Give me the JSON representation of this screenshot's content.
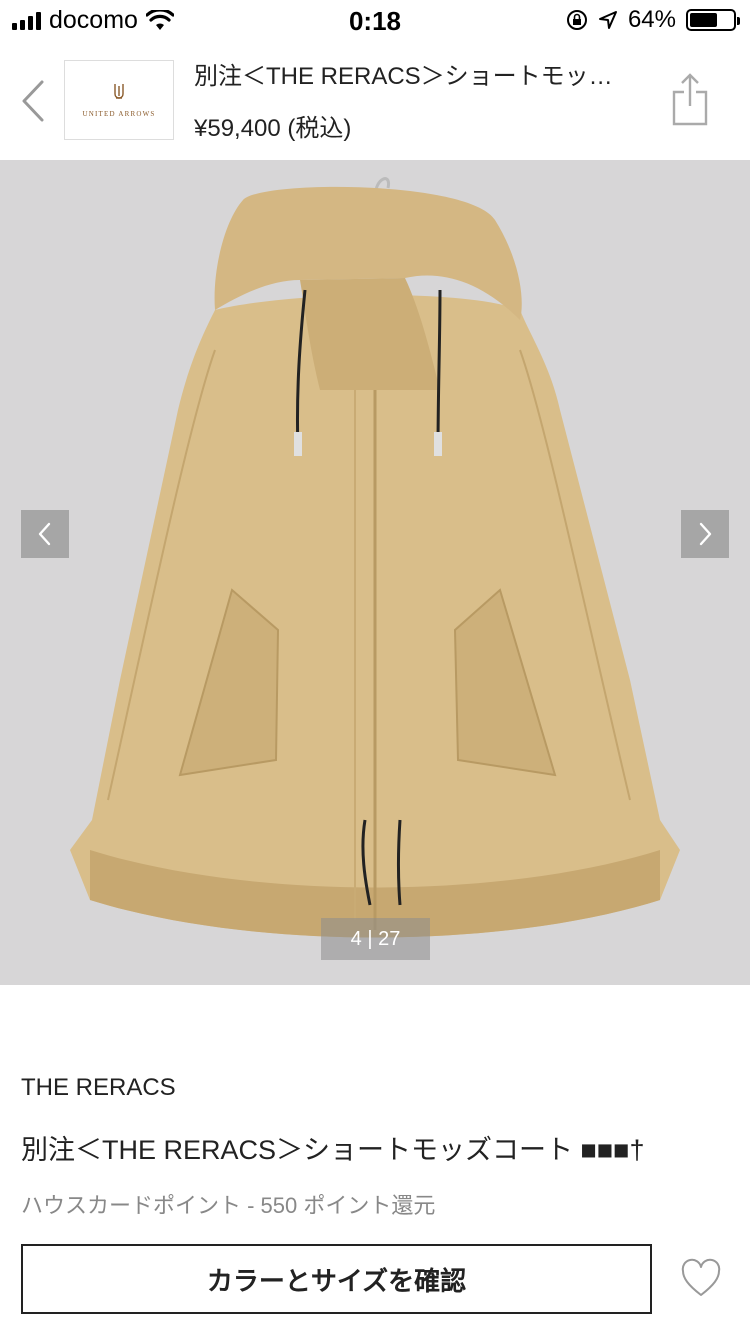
{
  "status_bar": {
    "carrier": "docomo",
    "time": "0:18",
    "battery_text": "64%",
    "battery_level": 0.64,
    "icons": [
      "signal-icon",
      "wifi-icon",
      "rotation-lock-icon",
      "location-icon",
      "battery-icon"
    ]
  },
  "header": {
    "brand_logo_text": "UNITED ARROWS",
    "title": "別注＜THE RERACS＞ショートモッ…",
    "price": "¥59,400 (税込)"
  },
  "gallery": {
    "page_indicator": "4 | 27",
    "image_subject": "beige hooded mods coat",
    "colors": {
      "background": "#d7d6d7",
      "coat": "#d9be8a"
    }
  },
  "product": {
    "brand": "THE RERACS",
    "name": "別注＜THE RERACS＞ショートモッズコート ■■■†",
    "points": "ハウスカードポイント - 550 ポイント還元",
    "cta_label": "カラーとサイズを確認"
  }
}
